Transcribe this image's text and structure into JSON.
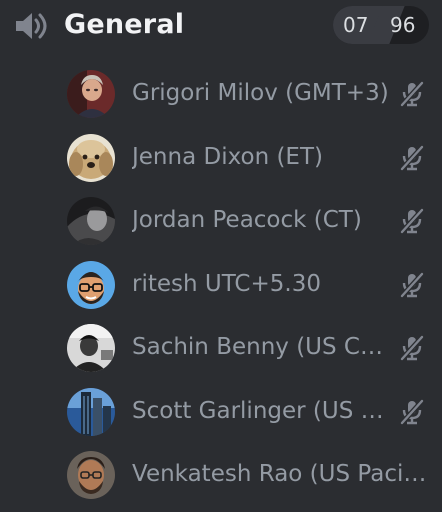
{
  "channel": {
    "icon": "speaker-icon",
    "name": "General",
    "user_count": "07",
    "user_limit": "96"
  },
  "users": [
    {
      "name": "Grigori Milov (GMT+3)",
      "avatar": "avatar-photo",
      "muted": true
    },
    {
      "name": "Jenna Dixon (ET)",
      "avatar": "avatar-dog",
      "muted": true
    },
    {
      "name": "Jordan Peacock (CT)",
      "avatar": "avatar-photo",
      "muted": true
    },
    {
      "name": "ritesh UTC+5.30",
      "avatar": "avatar-memoji",
      "muted": true
    },
    {
      "name": "Sachin Benny (US Central)",
      "avatar": "avatar-photo",
      "muted": true
    },
    {
      "name": "Scott Garlinger (US Eastern)",
      "avatar": "avatar-photo",
      "muted": true
    },
    {
      "name": "Venkatesh Rao (US Pacific)",
      "avatar": "avatar-photo",
      "muted": false
    }
  ],
  "colors": {
    "background": "#2b2d31",
    "channel_name": "#f2f3f5",
    "user_text": "#949ba4",
    "counter_left_bg": "#3a3c42",
    "counter_right_bg": "#1e1f22"
  }
}
